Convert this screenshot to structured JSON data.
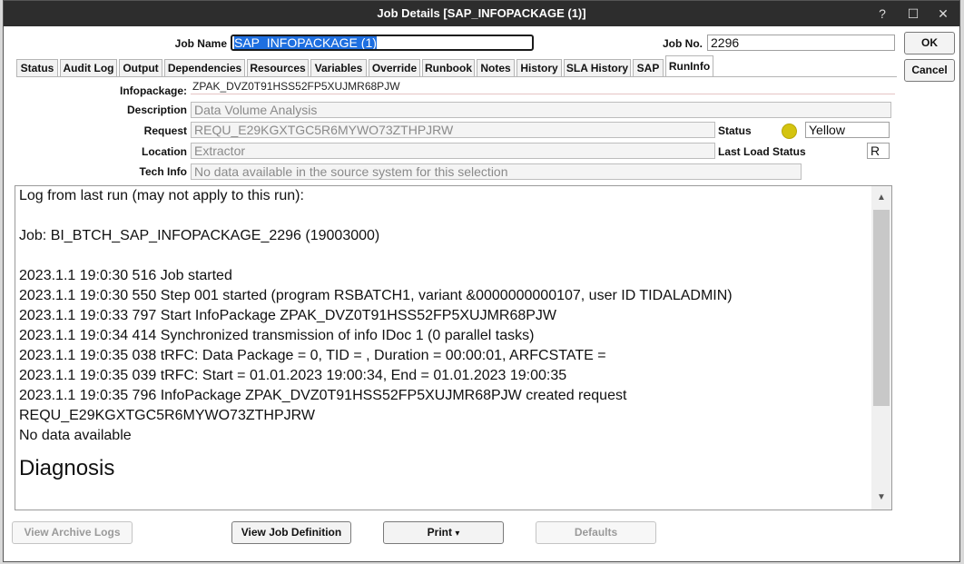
{
  "window": {
    "title": "Job Details [SAP_INFOPACKAGE (1)]",
    "controls": {
      "help": "?",
      "maximize": "☐",
      "close": "✕"
    }
  },
  "header": {
    "job_name_label": "Job Name",
    "job_name_value": "SAP_INFOPACKAGE (1)",
    "job_no_label": "Job No.",
    "job_no_value": "2296",
    "ok_label": "OK",
    "cancel_label": "Cancel"
  },
  "tabs": [
    {
      "label": "Status"
    },
    {
      "label": "Audit Log"
    },
    {
      "label": "Output"
    },
    {
      "label": "Dependencies"
    },
    {
      "label": "Resources"
    },
    {
      "label": "Variables"
    },
    {
      "label": "Override"
    },
    {
      "label": "Runbook"
    },
    {
      "label": "Notes"
    },
    {
      "label": "History"
    },
    {
      "label": "SLA History"
    },
    {
      "label": "SAP"
    },
    {
      "label": "RunInfo"
    }
  ],
  "active_tab": "RunInfo",
  "runinfo": {
    "infopackage_label": "Infopackage:",
    "infopackage_value": "ZPAK_DVZ0T91HSS52FP5XUJMR68PJW",
    "description_label": "Description",
    "description_value": "Data Volume Analysis",
    "request_label": "Request",
    "request_value": "REQU_E29KGXTGC5R6MYWO73ZTHPJRW",
    "status_label": "Status",
    "status_value": "Yellow",
    "status_color": "#d4c40f",
    "location_label": "Location",
    "location_value": "Extractor",
    "last_load_status_label": "Last Load Status",
    "last_load_status_value": "R",
    "tech_info_label": "Tech Info",
    "tech_info_value": "No data available in the source system for this selection"
  },
  "log": {
    "lines": [
      "Log from last run (may not apply to this run):",
      "",
      "Job: BI_BTCH_SAP_INFOPACKAGE_2296 (19003000)",
      "",
      "2023.1.1 19:0:30 516 Job started",
      "2023.1.1 19:0:30 550 Step 001 started (program RSBATCH1, variant &0000000000107, user ID TIDALADMIN)",
      "2023.1.1 19:0:33 797 Start InfoPackage ZPAK_DVZ0T91HSS52FP5XUJMR68PJW",
      "2023.1.1 19:0:34 414 Synchronized transmission of info IDoc 1 (0 parallel tasks)",
      "2023.1.1 19:0:35 038 tRFC: Data Package = 0, TID = , Duration = 00:00:01, ARFCSTATE =",
      "2023.1.1 19:0:35 039 tRFC: Start = 01.01.2023 19:00:34, End = 01.01.2023 19:00:35",
      "2023.1.1 19:0:35 796 InfoPackage ZPAK_DVZ0T91HSS52FP5XUJMR68PJW created request",
      "REQU_E29KGXTGC5R6MYWO73ZTHPJRW",
      "No data available"
    ],
    "heading": "Diagnosis"
  },
  "footer": {
    "view_archive_logs": "View Archive Logs",
    "view_job_definition": "View Job Definition",
    "print": "Print",
    "print_arrow": "▾",
    "defaults": "Defaults"
  }
}
